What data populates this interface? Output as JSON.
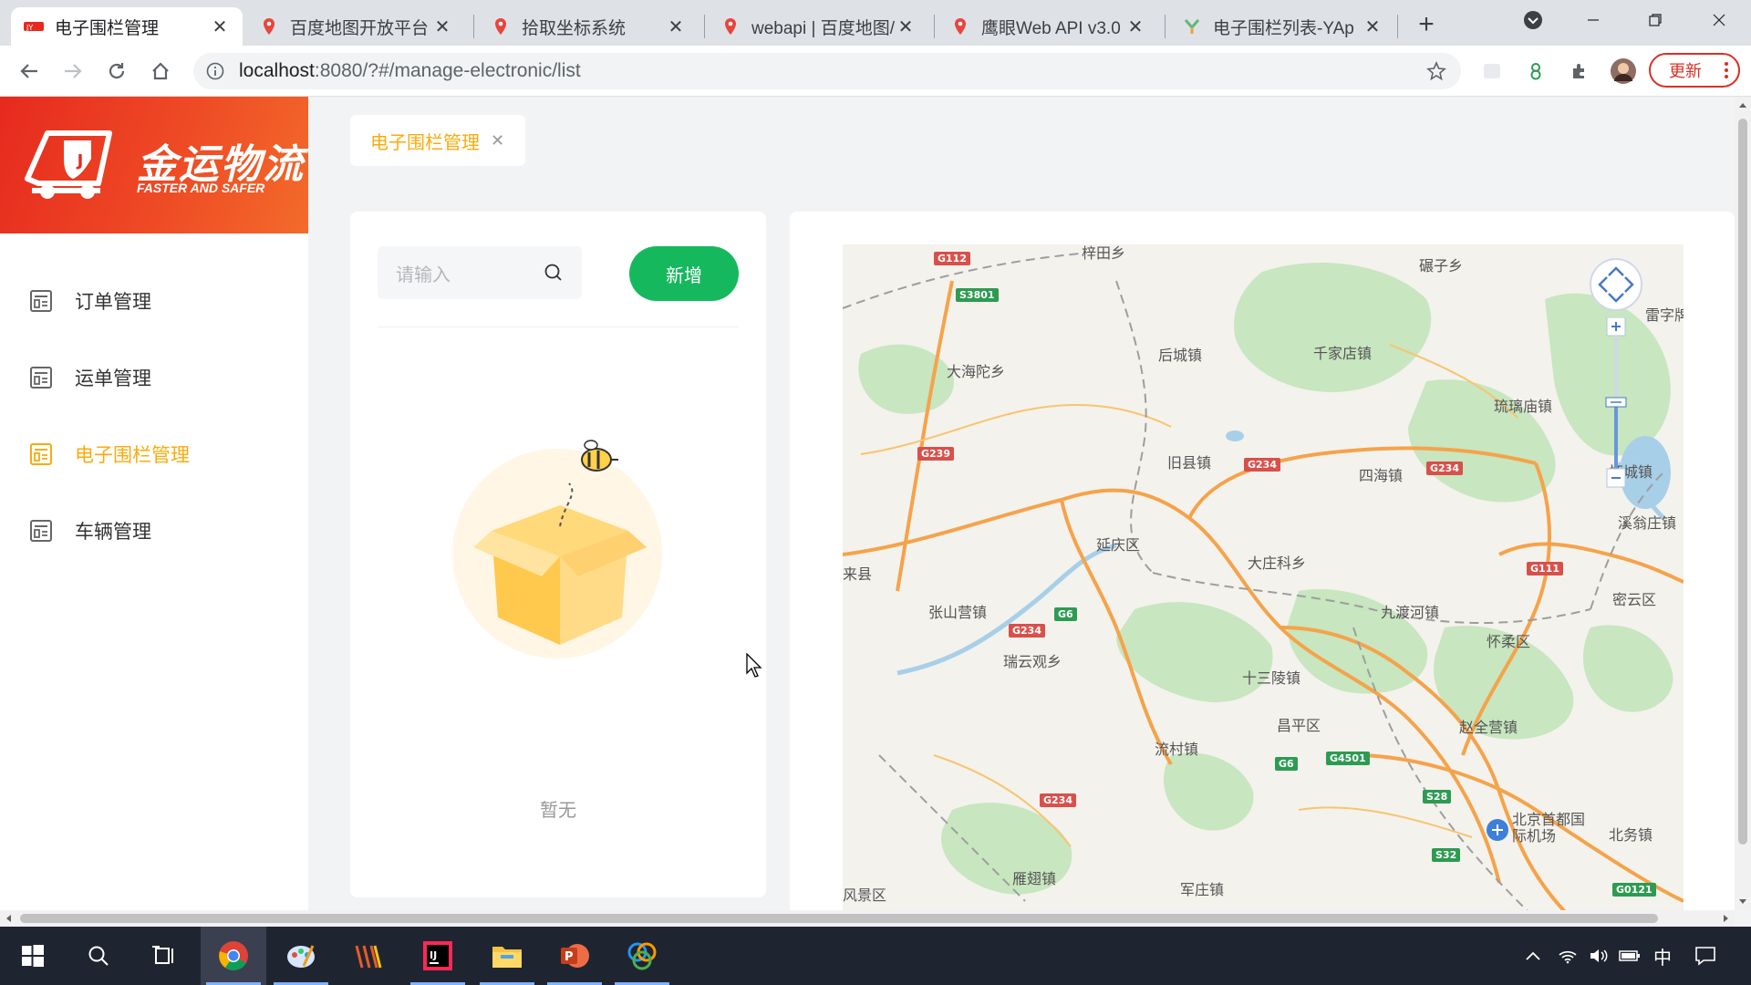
{
  "browser": {
    "tabs": [
      {
        "label": "电子围栏管理",
        "icon": "logo-favicon-icon",
        "active": true
      },
      {
        "label": "百度地图开放平台 |",
        "icon": "map-pin-icon"
      },
      {
        "label": "拾取坐标系统",
        "icon": "map-pin-icon"
      },
      {
        "label": "webapi | 百度地图/",
        "icon": "map-pin-icon"
      },
      {
        "label": "鹰眼Web API v3.0",
        "icon": "map-pin-icon"
      },
      {
        "label": "电子围栏列表-YAp",
        "icon": "yapi-icon"
      }
    ],
    "url_host": "localhost",
    "url_path": ":8080/?#/manage-electronic/list",
    "update_label": "更新"
  },
  "sidebar": {
    "logo_text": "金运物流",
    "logo_slogan": "FASTER AND SAFER",
    "items": [
      {
        "label": "订单管理",
        "active": false
      },
      {
        "label": "运单管理",
        "active": false
      },
      {
        "label": "电子围栏管理",
        "active": true
      },
      {
        "label": "车辆管理",
        "active": false
      }
    ]
  },
  "tagbar": {
    "tab_label": "电子围栏管理"
  },
  "panel": {
    "search_placeholder": "请输入",
    "add_label": "新增",
    "empty_text": "暂无"
  },
  "map": {
    "place_labels": [
      "梓田乡",
      "碾子乡",
      "雷字牌",
      "后城镇",
      "千家店镇",
      "大海陀乡",
      "琉璃庙镇",
      "旧县镇",
      "四海镇",
      "怀城镇",
      "延庆区",
      "大庄科乡",
      "溪翁庄镇",
      "来县",
      "张山营镇",
      "九渡河镇",
      "密云区",
      "瑞云观乡",
      "十三陵镇",
      "怀柔区",
      "昌平区",
      "赵全营镇",
      "流村镇",
      "北京首都国际机场",
      "北务镇",
      "雁翅镇",
      "军庄镇",
      "风景区"
    ],
    "road_shields": [
      "G112",
      "S3801",
      "G239",
      "G234",
      "G234",
      "G6",
      "G234",
      "G111",
      "G6",
      "G4501",
      "S28",
      "G234",
      "S32",
      "G0121"
    ]
  },
  "colors": {
    "accent": "#faab0c",
    "primary_green": "#16b85e",
    "danger": "#d93025"
  },
  "taskbar": {
    "ime_label": "中"
  }
}
